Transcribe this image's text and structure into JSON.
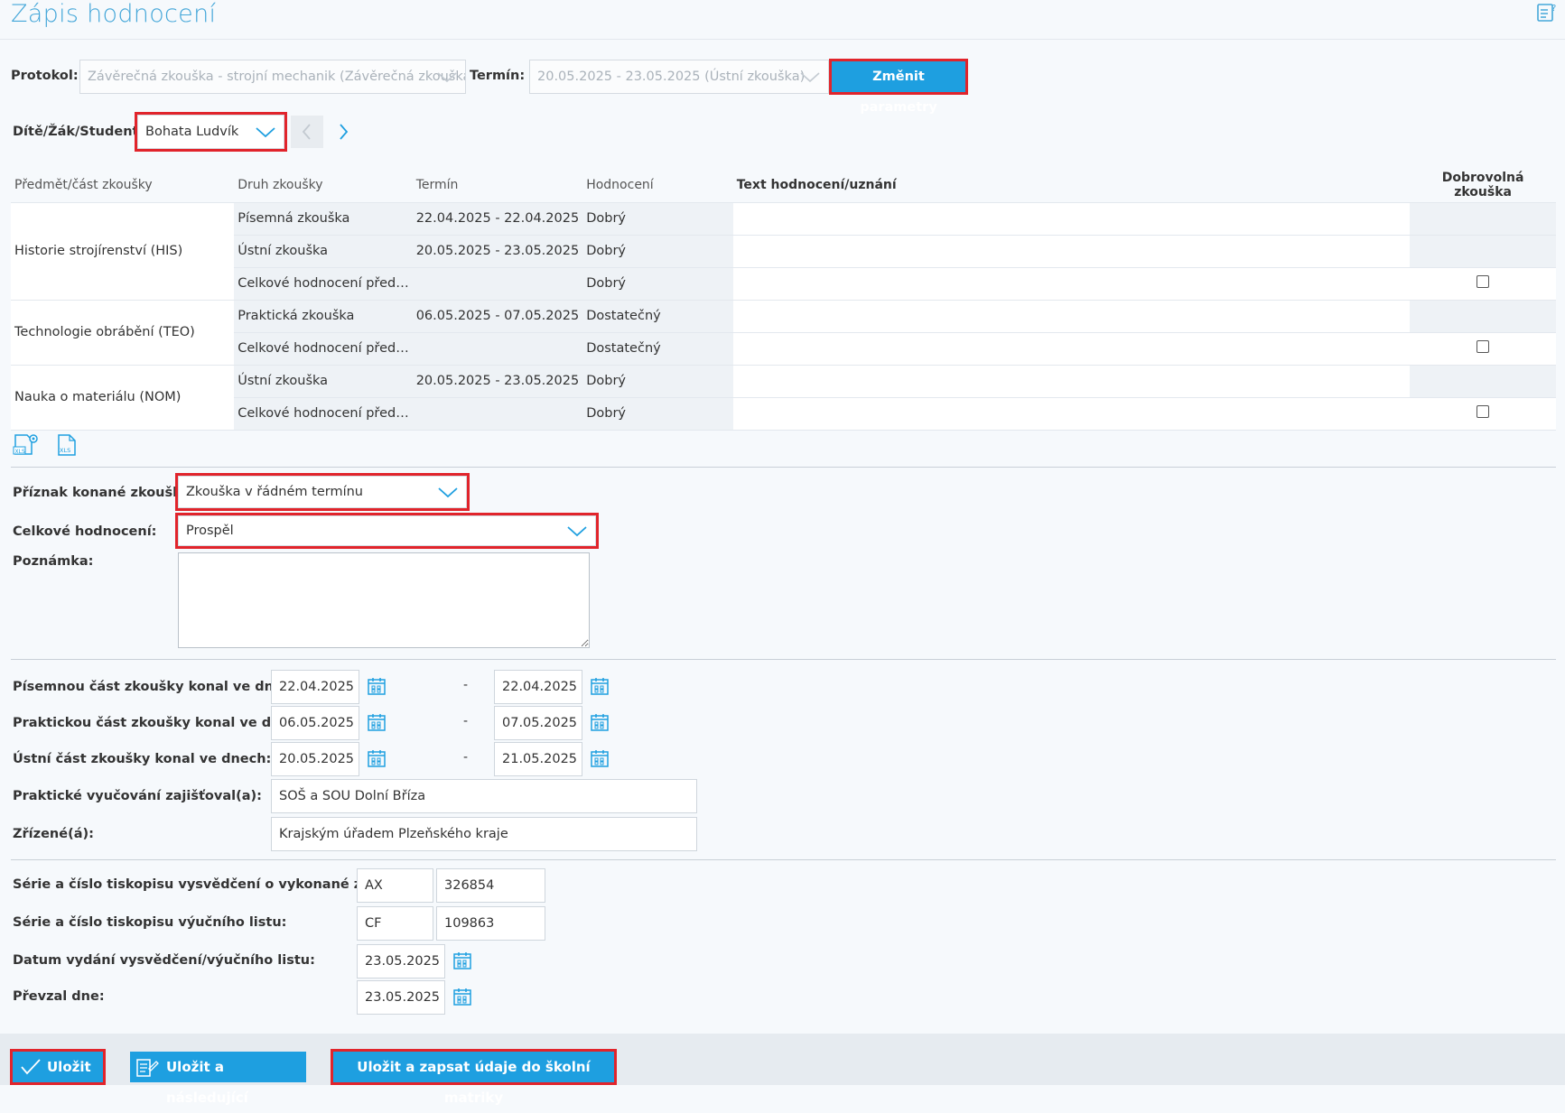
{
  "page": {
    "title": "Zápis hodnocení"
  },
  "protocol": {
    "label": "Protokol:",
    "value": "Závěrečná zkouška - strojní mechanik (Závěrečná zkouška)",
    "term_label": "Termín:",
    "term_value": "20.05.2025 - 23.05.2025 (Ústní zkouška)",
    "change_button": "Změnit parametry"
  },
  "student": {
    "label": "Dítě/Žák/Student:",
    "value": "Bohata Ludvík"
  },
  "table": {
    "headers": [
      "Předmět/část zkoušky",
      "Druh zkoušky",
      "Termín",
      "Hodnocení",
      "Text hodnocení/uznání",
      "Dobrovolná zkouška"
    ],
    "groups": [
      {
        "subject": "Historie strojírenství (HIS)",
        "rows": [
          {
            "type": "Písemná zkouška",
            "term": "22.04.2025 - 22.04.2025",
            "grade": "Dobrý",
            "text": "",
            "voluntary": false
          },
          {
            "type": "Ústní zkouška",
            "term": "20.05.2025 - 23.05.2025",
            "grade": "Dobrý",
            "text": "",
            "voluntary": false
          },
          {
            "type": "Celkové hodnocení před…",
            "term": "",
            "grade": "Dobrý",
            "text": "",
            "voluntary": true
          }
        ]
      },
      {
        "subject": "Technologie obrábění (TEO)",
        "rows": [
          {
            "type": "Praktická zkouška",
            "term": "06.05.2025 - 07.05.2025",
            "grade": "Dostatečný",
            "text": "",
            "voluntary": false
          },
          {
            "type": "Celkové hodnocení před…",
            "term": "",
            "grade": "Dostatečný",
            "text": "",
            "voluntary": true
          }
        ]
      },
      {
        "subject": "Nauka o materiálu (NOM)",
        "rows": [
          {
            "type": "Ústní zkouška",
            "term": "20.05.2025 - 23.05.2025",
            "grade": "Dobrý",
            "text": "",
            "voluntary": false
          },
          {
            "type": "Celkové hodnocení před…",
            "term": "",
            "grade": "Dobrý",
            "text": "",
            "voluntary": true
          }
        ]
      }
    ]
  },
  "form": {
    "flag_label": "Příznak konané zkoušky:",
    "flag_value": "Zkouška v řádném termínu",
    "overall_label": "Celkové hodnocení:",
    "overall_value": "Prospěl",
    "note_label": "Poznámka:",
    "note_value": ""
  },
  "dates": {
    "written_label": "Písemnou část zkoušky konal ve dnech:",
    "written_from": "22.04.2025",
    "written_to": "22.04.2025",
    "practical_label": "Praktickou část zkoušky konal ve dnech:",
    "practical_from": "06.05.2025",
    "practical_to": "07.05.2025",
    "oral_label": "Ústní část zkoušky konal ve dnech:",
    "oral_from": "20.05.2025",
    "oral_to": "21.05.2025",
    "dash": "-",
    "training_label": "Praktické vyučování zajišťoval(a):",
    "training_value": "SOŠ a SOU Dolní Bříza",
    "founder_label": "Zřízené(á):",
    "founder_value": "Krajským úřadem Plzeňského kraje"
  },
  "certificate": {
    "cert_label": "Série a číslo tiskopisu vysvědčení o vykonané zkoušce:",
    "cert_series": "AX",
    "cert_number": "326854",
    "diploma_label": "Série a číslo tiskopisu výučního listu:",
    "diploma_series": "CF",
    "diploma_number": "109863",
    "issue_label": "Datum vydání vysvědčení/výučního listu:",
    "issue_date": "23.05.2025",
    "received_label": "Převzal dne:",
    "received_date": "23.05.2025"
  },
  "footer": {
    "save": "Uložit",
    "save_next": "Uložit a následující",
    "save_registry": "Uložit a zapsat údaje do školní matriky"
  },
  "icons": {
    "chevron": "chevron-down-icon",
    "calendar": "calendar-icon",
    "xls_settings": "xls-settings-icon",
    "xls_export": "xls-icon"
  }
}
